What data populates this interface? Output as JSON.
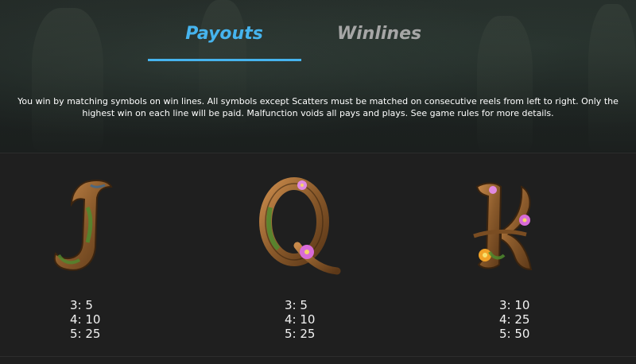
{
  "tabs": [
    {
      "label": "Payouts",
      "active": true
    },
    {
      "label": "Winlines",
      "active": false
    }
  ],
  "rules_text": "You win by matching symbols on win lines. All symbols except Scatters must be matched on consecutive reels from left to right. Only the highest win on each line will be paid. Malfunction voids all pays and plays. See game rules for more details.",
  "symbols": [
    {
      "icon": "letter-j-wood-symbol-icon",
      "pays": [
        {
          "count": "3:",
          "value": "5"
        },
        {
          "count": "4:",
          "value": "10"
        },
        {
          "count": "5:",
          "value": "25"
        }
      ]
    },
    {
      "icon": "letter-q-wood-symbol-icon",
      "pays": [
        {
          "count": "3:",
          "value": "5"
        },
        {
          "count": "4:",
          "value": "10"
        },
        {
          "count": "5:",
          "value": "25"
        }
      ]
    },
    {
      "icon": "letter-k-wood-symbol-icon",
      "pays": [
        {
          "count": "3:",
          "value": "10"
        },
        {
          "count": "4:",
          "value": "25"
        },
        {
          "count": "5:",
          "value": "50"
        }
      ]
    }
  ],
  "colors": {
    "accent": "#46b4ee",
    "inactive_tab": "#a6a6a6",
    "background": "#1f1f1f",
    "wood": "#8a5a2b",
    "moss": "#4f8a2e",
    "flower": "#d86bd8"
  }
}
